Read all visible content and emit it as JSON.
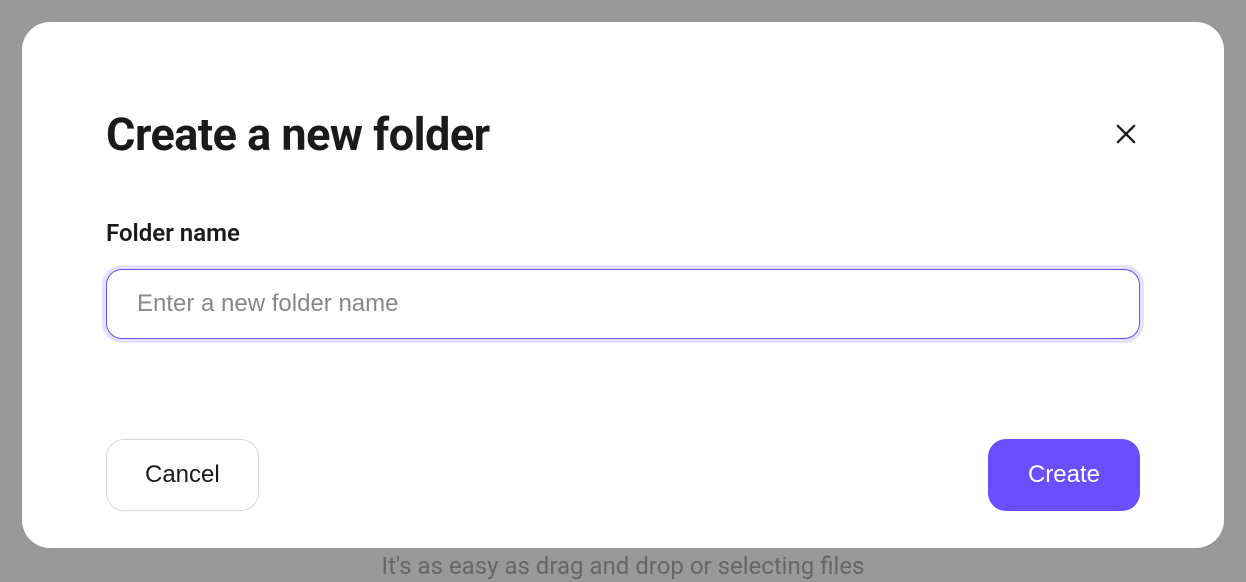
{
  "background": {
    "hint_text": "It's as easy as drag and drop or selecting files"
  },
  "modal": {
    "title": "Create a new folder",
    "form": {
      "folder_name_label": "Folder name",
      "folder_name_placeholder": "Enter a new folder name",
      "folder_name_value": ""
    },
    "buttons": {
      "cancel_label": "Cancel",
      "create_label": "Create"
    }
  },
  "colors": {
    "accent": "#6b4eff",
    "focus_ring": "#e6e0ff"
  }
}
